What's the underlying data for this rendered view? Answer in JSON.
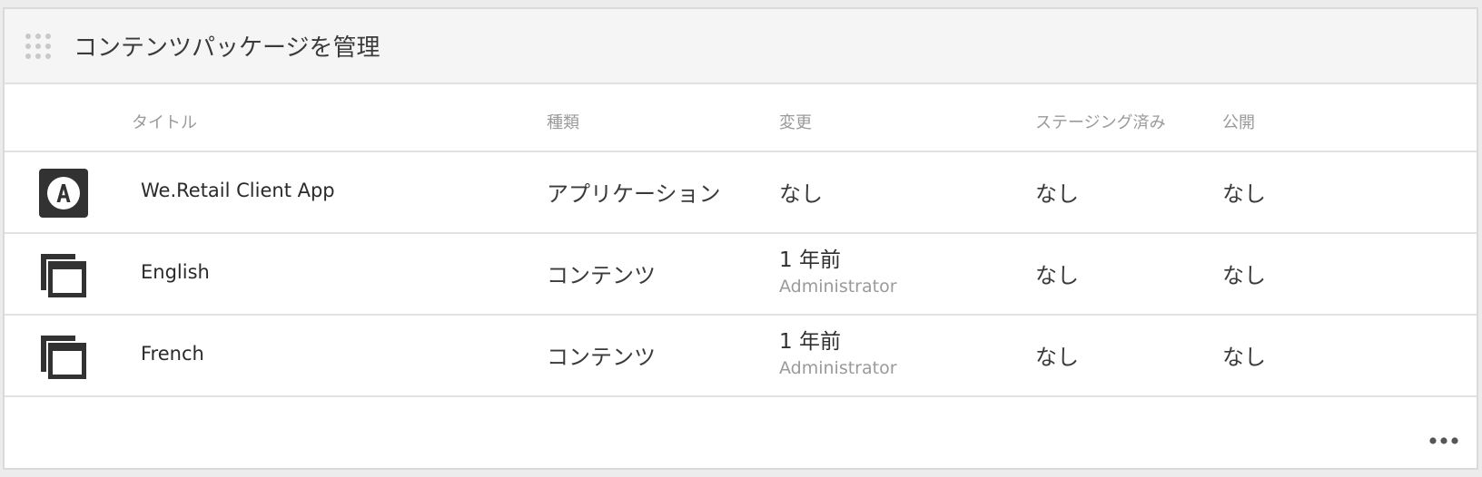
{
  "card": {
    "title": "コンテンツパッケージを管理"
  },
  "columns": {
    "title": "タイトル",
    "type": "種類",
    "modified": "変更",
    "staged": "ステージング済み",
    "published": "公開"
  },
  "rows": [
    {
      "icon": "app-icon",
      "title": "We.Retail Client App",
      "type": "アプリケーション",
      "modified": "なし",
      "modified_by": "",
      "staged": "なし",
      "published": "なし"
    },
    {
      "icon": "content-pages-icon",
      "title": "English",
      "type": "コンテンツ",
      "modified": "1 年前",
      "modified_by": "Administrator",
      "staged": "なし",
      "published": "なし"
    },
    {
      "icon": "content-pages-icon",
      "title": "French",
      "type": "コンテンツ",
      "modified": "1 年前",
      "modified_by": "Administrator",
      "staged": "なし",
      "published": "なし"
    }
  ],
  "footer": {
    "more_icon": "more-icon"
  },
  "colors": {
    "header_bg": "#f5f5f5",
    "icon_dark": "#323232",
    "muted_text": "#9a9a9a"
  }
}
